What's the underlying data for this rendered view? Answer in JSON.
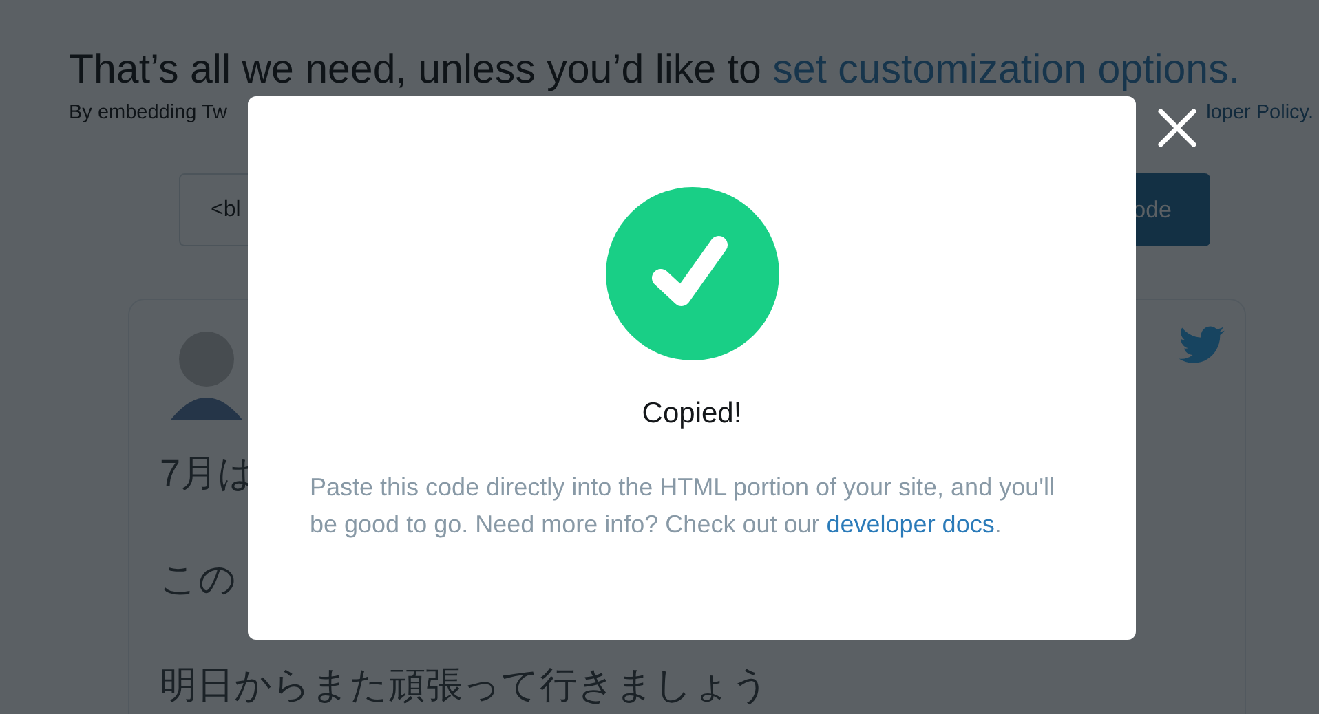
{
  "page": {
    "heading": "That’s all we need, unless you’d like to ",
    "heading_link": "set customization options.",
    "note_left": "By embedding Tw",
    "note_right": "loper Policy.",
    "code_field": "<bl",
    "copy_button": "ode"
  },
  "tweet": {
    "lines": [
      "7月は",
      "この",
      "明日からまた頑張って行きましょう"
    ]
  },
  "modal": {
    "title": "Copied!",
    "message": "Paste this code directly into the HTML portion of your site, and you'll be good to go. Need more info? Check out our ",
    "link": "developer docs",
    "after_link": "."
  }
}
